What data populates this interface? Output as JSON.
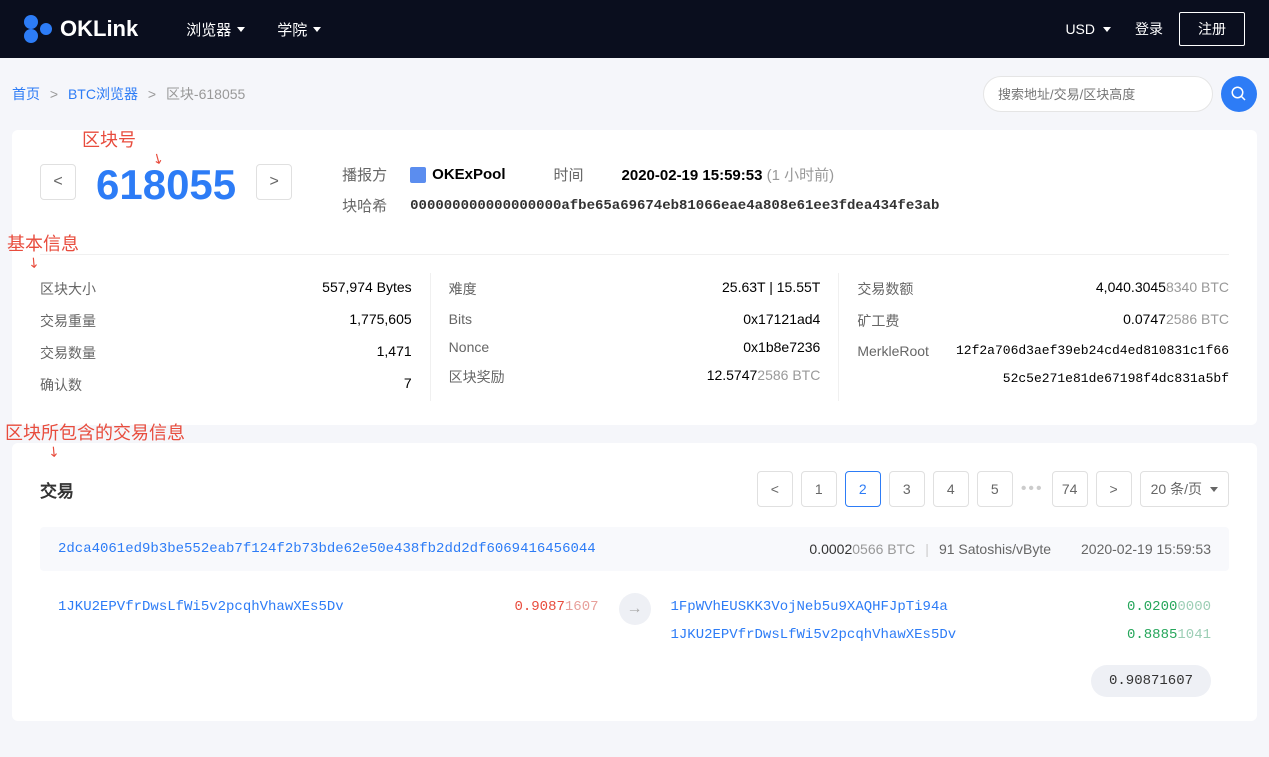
{
  "header": {
    "logo": "OKLink",
    "nav": {
      "browser": "浏览器",
      "academy": "学院"
    },
    "currency": "USD",
    "login": "登录",
    "register": "注册"
  },
  "breadcrumb": {
    "home": "首页",
    "btc": "BTC浏览器",
    "current": "区块-618055"
  },
  "search": {
    "placeholder": "搜索地址/交易/区块高度"
  },
  "annotations": {
    "block_num": "区块号",
    "basic_info": "基本信息",
    "tx_info": "区块所包含的交易信息"
  },
  "block": {
    "number": "618055",
    "labels": {
      "broadcaster": "播报方",
      "time": "时间",
      "hash": "块哈希"
    },
    "pool": "OKExPool",
    "time": "2020-02-19 15:59:53",
    "time_ago": "(1 小时前)",
    "hash": "000000000000000000afbe65a69674eb81066eae4a808e61ee3fdea434fe3ab"
  },
  "info": {
    "col1": {
      "size_label": "区块大小",
      "size_val": "557,974 Bytes",
      "weight_label": "交易重量",
      "weight_val": "1,775,605",
      "count_label": "交易数量",
      "count_val": "1,471",
      "confirm_label": "确认数",
      "confirm_val": "7"
    },
    "col2": {
      "diff_label": "难度",
      "diff_val": "25.63T | 15.55T",
      "bits_label": "Bits",
      "bits_val": "0x17121ad4",
      "nonce_label": "Nonce",
      "nonce_val": "0x1b8e7236",
      "reward_label": "区块奖励",
      "reward_val_a": "12.5747",
      "reward_val_b": "2586 BTC"
    },
    "col3": {
      "amount_label": "交易数额",
      "amount_val_a": "4,040.3045",
      "amount_val_b": "8340 BTC",
      "fee_label": "矿工费",
      "fee_val_a": "0.0747",
      "fee_val_b": "2586 BTC",
      "merkle_label": "MerkleRoot",
      "merkle_val1": "12f2a706d3aef39eb24cd4ed810831c1f66",
      "merkle_val2": "52c5e271e81de67198f4dc831a5bf"
    }
  },
  "tx": {
    "title": "交易",
    "pages": {
      "p1": "1",
      "p2": "2",
      "p3": "3",
      "p4": "4",
      "p5": "5",
      "last": "74"
    },
    "per_page": "20 条/页",
    "hash": "2dca4061ed9b3be552eab7f124f2b73bde62e50e438fb2dd2df6069416456044",
    "fee_a": "0.0002",
    "fee_b": "0566 BTC",
    "satoshi": "91 Satoshis/vByte",
    "time": "2020-02-19 15:59:53",
    "in_addr": "1JKU2EPVfrDwsLfWi5v2pcqhVhawXEs5Dv",
    "in_amt_a": "0.9087",
    "in_amt_b": "1607",
    "out1_addr": "1FpWVhEUSKK3VojNeb5u9XAQHFJpTi94a",
    "out1_amt_a": "0.0200",
    "out1_amt_b": "0000",
    "out2_addr": "1JKU2EPVfrDwsLfWi5v2pcqhVhawXEs5Dv",
    "out2_amt_a": "0.8885",
    "out2_amt_b": "1041",
    "total": "0.90871607"
  }
}
